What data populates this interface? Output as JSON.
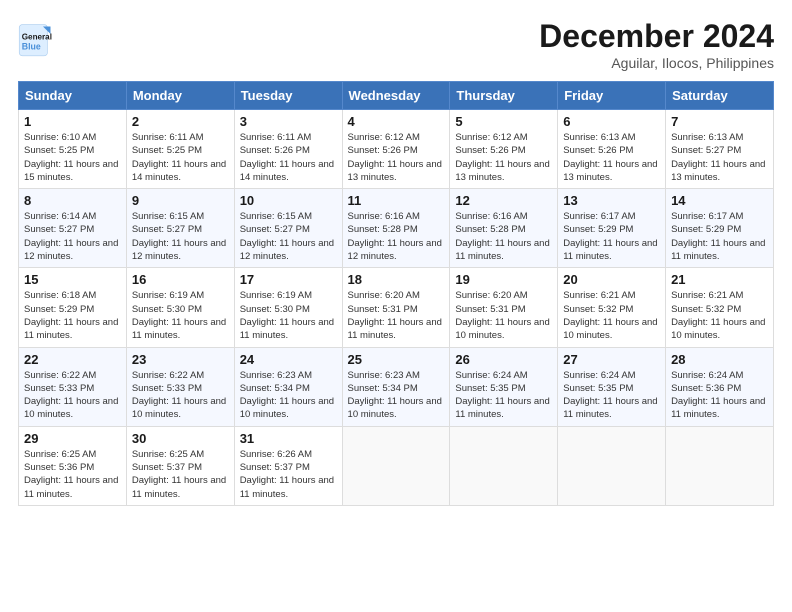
{
  "header": {
    "logo_line1": "General",
    "logo_line2": "Blue",
    "month_year": "December 2024",
    "location": "Aguilar, Ilocos, Philippines"
  },
  "days_of_week": [
    "Sunday",
    "Monday",
    "Tuesday",
    "Wednesday",
    "Thursday",
    "Friday",
    "Saturday"
  ],
  "weeks": [
    [
      {
        "day": 1,
        "sunrise": "6:10 AM",
        "sunset": "5:25 PM",
        "daylight": "11 hours and 15 minutes"
      },
      {
        "day": 2,
        "sunrise": "6:11 AM",
        "sunset": "5:25 PM",
        "daylight": "11 hours and 14 minutes"
      },
      {
        "day": 3,
        "sunrise": "6:11 AM",
        "sunset": "5:26 PM",
        "daylight": "11 hours and 14 minutes"
      },
      {
        "day": 4,
        "sunrise": "6:12 AM",
        "sunset": "5:26 PM",
        "daylight": "11 hours and 13 minutes"
      },
      {
        "day": 5,
        "sunrise": "6:12 AM",
        "sunset": "5:26 PM",
        "daylight": "11 hours and 13 minutes"
      },
      {
        "day": 6,
        "sunrise": "6:13 AM",
        "sunset": "5:26 PM",
        "daylight": "11 hours and 13 minutes"
      },
      {
        "day": 7,
        "sunrise": "6:13 AM",
        "sunset": "5:27 PM",
        "daylight": "11 hours and 13 minutes"
      }
    ],
    [
      {
        "day": 8,
        "sunrise": "6:14 AM",
        "sunset": "5:27 PM",
        "daylight": "11 hours and 12 minutes"
      },
      {
        "day": 9,
        "sunrise": "6:15 AM",
        "sunset": "5:27 PM",
        "daylight": "11 hours and 12 minutes"
      },
      {
        "day": 10,
        "sunrise": "6:15 AM",
        "sunset": "5:27 PM",
        "daylight": "11 hours and 12 minutes"
      },
      {
        "day": 11,
        "sunrise": "6:16 AM",
        "sunset": "5:28 PM",
        "daylight": "11 hours and 12 minutes"
      },
      {
        "day": 12,
        "sunrise": "6:16 AM",
        "sunset": "5:28 PM",
        "daylight": "11 hours and 11 minutes"
      },
      {
        "day": 13,
        "sunrise": "6:17 AM",
        "sunset": "5:29 PM",
        "daylight": "11 hours and 11 minutes"
      },
      {
        "day": 14,
        "sunrise": "6:17 AM",
        "sunset": "5:29 PM",
        "daylight": "11 hours and 11 minutes"
      }
    ],
    [
      {
        "day": 15,
        "sunrise": "6:18 AM",
        "sunset": "5:29 PM",
        "daylight": "11 hours and 11 minutes"
      },
      {
        "day": 16,
        "sunrise": "6:19 AM",
        "sunset": "5:30 PM",
        "daylight": "11 hours and 11 minutes"
      },
      {
        "day": 17,
        "sunrise": "6:19 AM",
        "sunset": "5:30 PM",
        "daylight": "11 hours and 11 minutes"
      },
      {
        "day": 18,
        "sunrise": "6:20 AM",
        "sunset": "5:31 PM",
        "daylight": "11 hours and 11 minutes"
      },
      {
        "day": 19,
        "sunrise": "6:20 AM",
        "sunset": "5:31 PM",
        "daylight": "11 hours and 10 minutes"
      },
      {
        "day": 20,
        "sunrise": "6:21 AM",
        "sunset": "5:32 PM",
        "daylight": "11 hours and 10 minutes"
      },
      {
        "day": 21,
        "sunrise": "6:21 AM",
        "sunset": "5:32 PM",
        "daylight": "11 hours and 10 minutes"
      }
    ],
    [
      {
        "day": 22,
        "sunrise": "6:22 AM",
        "sunset": "5:33 PM",
        "daylight": "11 hours and 10 minutes"
      },
      {
        "day": 23,
        "sunrise": "6:22 AM",
        "sunset": "5:33 PM",
        "daylight": "11 hours and 10 minutes"
      },
      {
        "day": 24,
        "sunrise": "6:23 AM",
        "sunset": "5:34 PM",
        "daylight": "11 hours and 10 minutes"
      },
      {
        "day": 25,
        "sunrise": "6:23 AM",
        "sunset": "5:34 PM",
        "daylight": "11 hours and 10 minutes"
      },
      {
        "day": 26,
        "sunrise": "6:24 AM",
        "sunset": "5:35 PM",
        "daylight": "11 hours and 11 minutes"
      },
      {
        "day": 27,
        "sunrise": "6:24 AM",
        "sunset": "5:35 PM",
        "daylight": "11 hours and 11 minutes"
      },
      {
        "day": 28,
        "sunrise": "6:24 AM",
        "sunset": "5:36 PM",
        "daylight": "11 hours and 11 minutes"
      }
    ],
    [
      {
        "day": 29,
        "sunrise": "6:25 AM",
        "sunset": "5:36 PM",
        "daylight": "11 hours and 11 minutes"
      },
      {
        "day": 30,
        "sunrise": "6:25 AM",
        "sunset": "5:37 PM",
        "daylight": "11 hours and 11 minutes"
      },
      {
        "day": 31,
        "sunrise": "6:26 AM",
        "sunset": "5:37 PM",
        "daylight": "11 hours and 11 minutes"
      },
      null,
      null,
      null,
      null
    ]
  ]
}
